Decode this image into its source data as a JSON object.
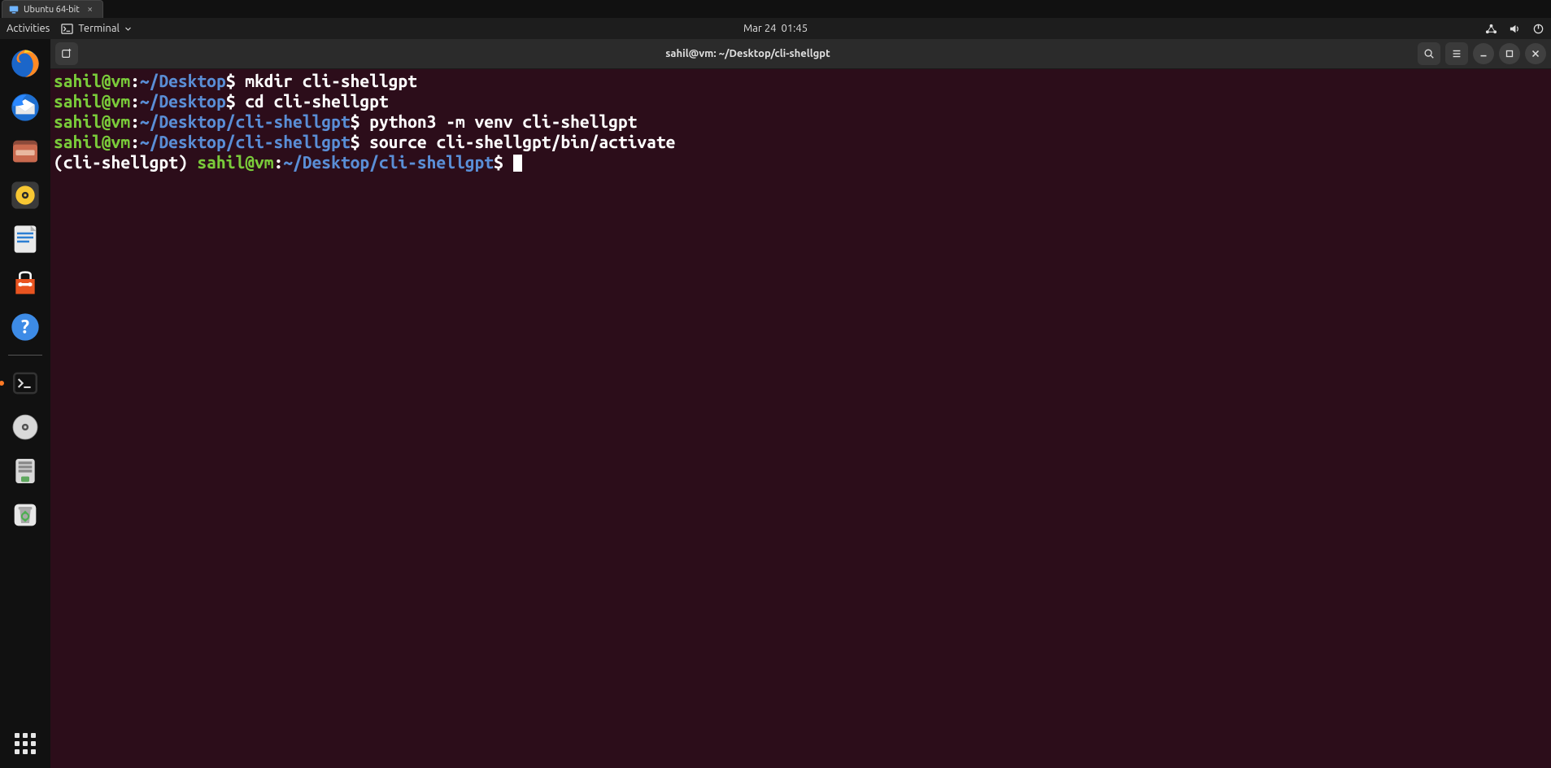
{
  "host": {
    "tab_label": "Ubuntu 64-bit"
  },
  "gnome": {
    "activities": "Activities",
    "app_name": "Terminal",
    "date": "Mar 24",
    "time": "01:45"
  },
  "dock": {
    "items": [
      {
        "name": "firefox"
      },
      {
        "name": "thunderbird"
      },
      {
        "name": "files"
      },
      {
        "name": "rhythmbox"
      },
      {
        "name": "libreoffice-writer"
      },
      {
        "name": "software"
      },
      {
        "name": "help"
      }
    ],
    "secondary": [
      {
        "name": "terminal",
        "active": true
      },
      {
        "name": "disc"
      },
      {
        "name": "usb-creator"
      },
      {
        "name": "trash"
      }
    ]
  },
  "window": {
    "title": "sahil@vm: ~/Desktop/cli-shellgpt"
  },
  "terminal": {
    "prompt_user": "sahil@vm",
    "colon": ":",
    "dollar": "$",
    "lines": [
      {
        "path": "~/Desktop",
        "cmd": "mkdir cli-shellgpt"
      },
      {
        "path": "~/Desktop",
        "cmd": "cd cli-shellgpt"
      },
      {
        "path": "~/Desktop/cli-shellgpt",
        "cmd": "python3 -m venv cli-shellgpt"
      },
      {
        "path": "~/Desktop/cli-shellgpt",
        "cmd": "source cli-shellgpt/bin/activate"
      }
    ],
    "venv_prefix": "(cli-shellgpt) ",
    "active_path": "~/Desktop/cli-shellgpt"
  }
}
